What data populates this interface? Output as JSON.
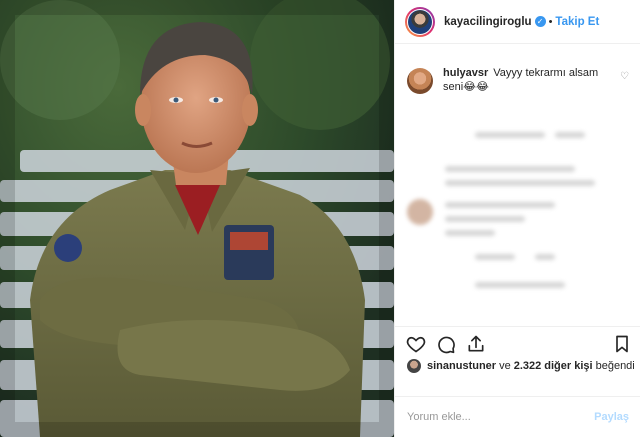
{
  "post": {
    "image": {
      "description_icon": "portrait-photo"
    },
    "author": {
      "username": "kayacilingiroglu",
      "verified": true,
      "follow_label": "Takip Et",
      "separator": "•"
    },
    "comment": {
      "username": "hulyavsr",
      "text": "Vayyy tekrarmı alsam seni😂😂"
    },
    "actions": {
      "icons": [
        "heart-icon",
        "comment-icon",
        "share-icon",
        "bookmark-icon"
      ]
    },
    "likes": {
      "first_user": "sinanustuner",
      "connector": "ve",
      "count_text": "2.322 diğer kişi",
      "suffix": "beğendi"
    },
    "add_comment": {
      "placeholder": "Yorum ekle...",
      "post_label": "Paylaş"
    }
  },
  "colors": {
    "link": "#3897f0",
    "text": "#262626",
    "muted": "#8e8e8e",
    "post_disabled": "#b3dbff"
  }
}
